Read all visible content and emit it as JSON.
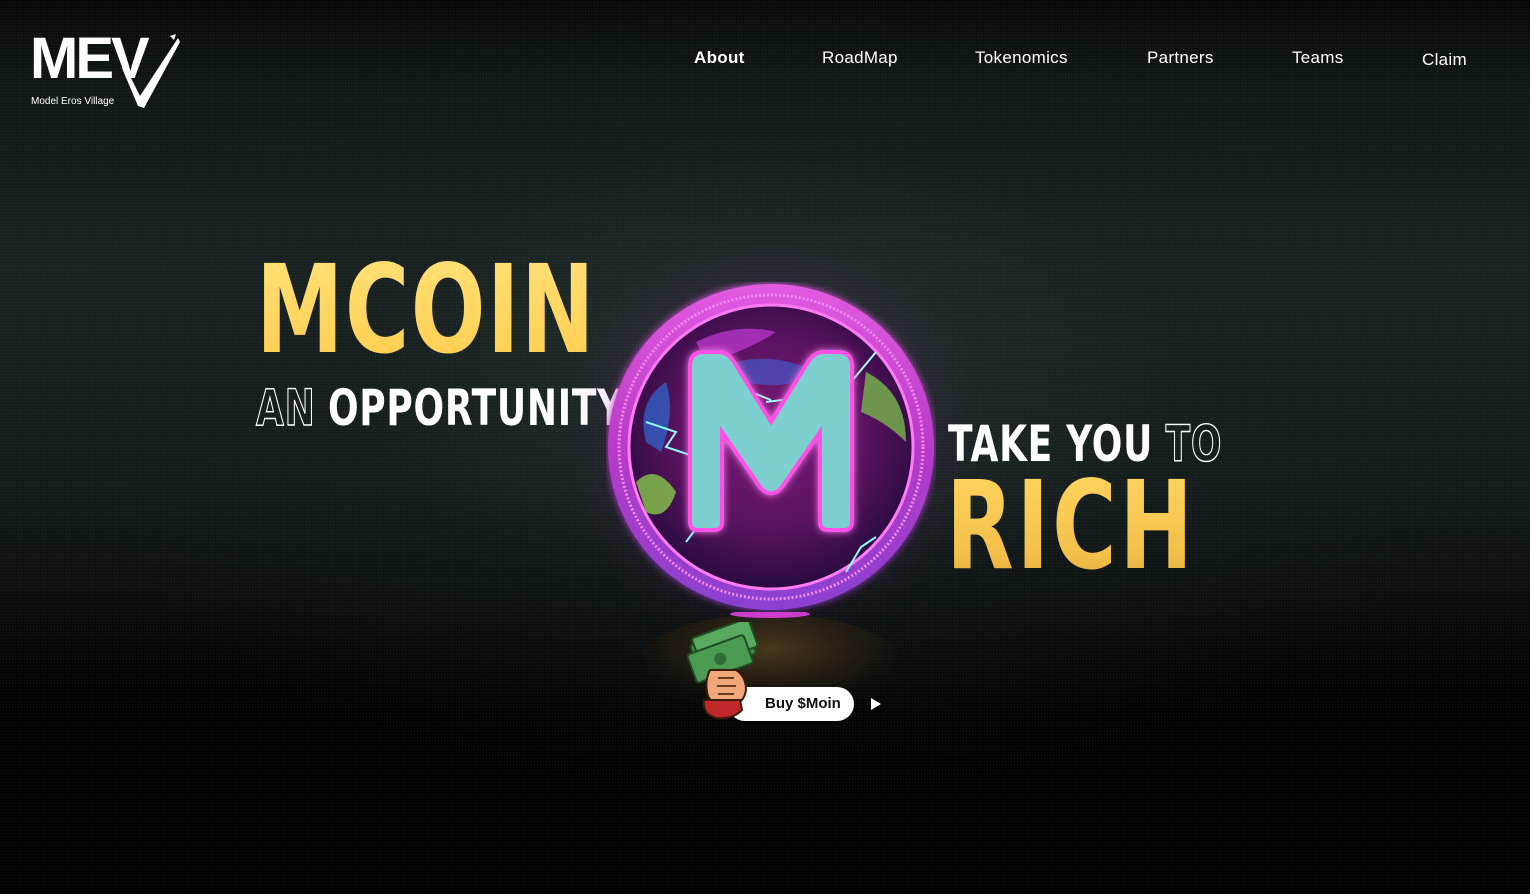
{
  "brand": {
    "logo_text": "MEV",
    "logo_subtitle": "Model Eros Village"
  },
  "nav": {
    "items": [
      {
        "label": "About",
        "active": true
      },
      {
        "label": "RoadMap",
        "active": false
      },
      {
        "label": "Tokenomics",
        "active": false
      },
      {
        "label": "Partners",
        "active": false
      },
      {
        "label": "Teams",
        "active": false
      },
      {
        "label": "Claim",
        "active": false
      }
    ]
  },
  "hero": {
    "title": "MCOIN",
    "line2_outline": "AN",
    "line2_solid": "OPPORTUNITY",
    "line3_solid": "TAKE YOU",
    "line3_outline": "TO",
    "title2": "RICH",
    "coin_letter": "M",
    "cta_label": "Buy $Moin"
  },
  "colors": {
    "accent_gold": "#ffd35c",
    "coin_magenta": "#c92bc9",
    "coin_letter": "#7ad1cf",
    "background": "#000000"
  },
  "icons": {
    "play": "play-icon",
    "money": "money-hand-icon"
  }
}
